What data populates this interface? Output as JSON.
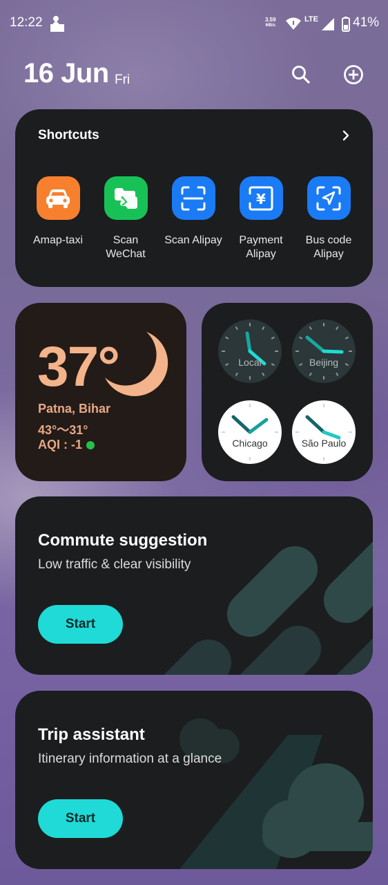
{
  "status_bar": {
    "time": "12:22",
    "net_speed": "3.59",
    "net_unit": "MB/s",
    "network": "LTE",
    "battery": "41%"
  },
  "header": {
    "date": "16 Jun",
    "day": "Fri",
    "search_icon": "search-icon",
    "add_icon": "add-circle-icon"
  },
  "shortcuts": {
    "title": "Shortcuts",
    "items": [
      {
        "label": "Amap-taxi",
        "icon": "taxi-icon",
        "color": "#f7802f"
      },
      {
        "label": "Scan\nWeChat",
        "icon": "wechat-scan-icon",
        "color": "#18c156"
      },
      {
        "label": "Scan Alipay",
        "icon": "scan-icon",
        "color": "#1b7bf5"
      },
      {
        "label": "Payment\nAlipay",
        "icon": "yuan-icon",
        "color": "#1b7bf5"
      },
      {
        "label": "Bus code\nAlipay",
        "icon": "navigation-icon",
        "color": "#1b7bf5"
      }
    ]
  },
  "weather": {
    "temperature": "37°",
    "location": "Patna, Bihar",
    "range": "43°～31°",
    "aqi": "AQI : -1",
    "accent": "#f3b38b"
  },
  "clocks": [
    {
      "name": "Local",
      "theme": "dark"
    },
    {
      "name": "Beijing",
      "theme": "dark"
    },
    {
      "name": "Chicago",
      "theme": "light"
    },
    {
      "name": "São Paulo",
      "theme": "light"
    }
  ],
  "commute": {
    "title": "Commute suggestion",
    "subtitle": "Low traffic & clear visibility",
    "button": "Start"
  },
  "trip": {
    "title": "Trip assistant",
    "subtitle": "Itinerary information at a glance",
    "button": "Start"
  },
  "colors": {
    "card": "#1b1d1f",
    "button": "#1fdad6",
    "clock_hand": "#1a9f9b"
  }
}
